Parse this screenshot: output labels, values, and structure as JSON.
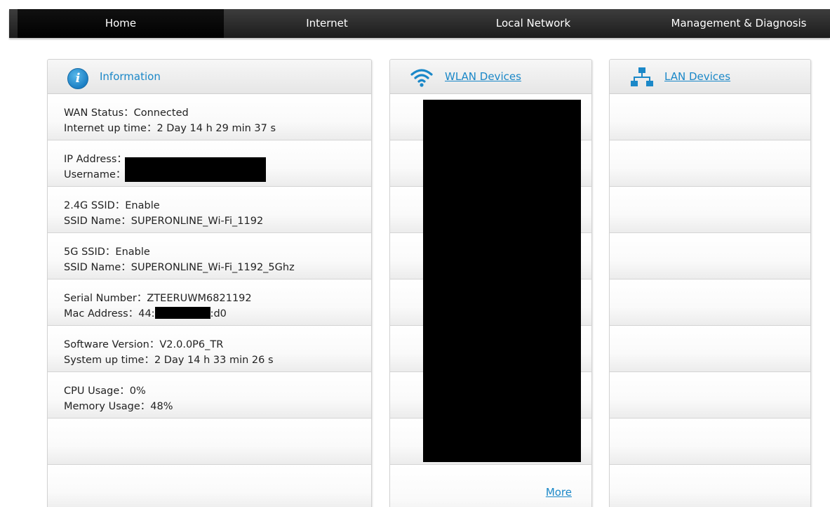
{
  "nav": {
    "items": [
      {
        "label": "Home",
        "active": true
      },
      {
        "label": "Internet",
        "active": false
      },
      {
        "label": "Local Network",
        "active": false
      },
      {
        "label": "Management & Diagnosis",
        "active": false
      }
    ]
  },
  "information": {
    "title": "Information",
    "icon": "info-icon",
    "rows": [
      {
        "line1_label": "WAN Status",
        "line1_value": "Connected",
        "line2_label": "Internet up time",
        "line2_value": "2 Day 14 h 29 min 37 s"
      },
      {
        "line1_label": "IP Address",
        "line1_value": "",
        "line2_label": "Username",
        "line2_value": ""
      },
      {
        "line1_label": "2.4G SSID",
        "line1_value": "Enable",
        "line2_label": "SSID Name",
        "line2_value": "SUPERONLINE_Wi-Fi_1192"
      },
      {
        "line1_label": "5G SSID",
        "line1_value": "Enable",
        "line2_label": "SSID Name",
        "line2_value": "SUPERONLINE_Wi-Fi_1192_5Ghz"
      },
      {
        "line1_label": "Serial Number",
        "line1_value": "ZTEERUWM6821192",
        "line2_label": "Mac Address",
        "line2_value": "44:",
        "line2_suffix": ":d0"
      },
      {
        "line1_label": "Software Version",
        "line1_value": "V2.0.0P6_TR",
        "line2_label": "System up time",
        "line2_value": "2 Day 14 h 33 min 26 s"
      },
      {
        "line1_label": "CPU Usage",
        "line1_value": "0%",
        "line2_label": "Memory Usage",
        "line2_value": "48%"
      }
    ],
    "separator": "："
  },
  "wlan": {
    "title": "WLAN Devices",
    "icon": "wifi-icon",
    "more_label": "More"
  },
  "lan": {
    "title": "LAN Devices",
    "icon": "network-icon"
  },
  "colors": {
    "accent": "#1b88c8",
    "nav_bg": "#2b2b2b",
    "nav_active": "#000000"
  }
}
